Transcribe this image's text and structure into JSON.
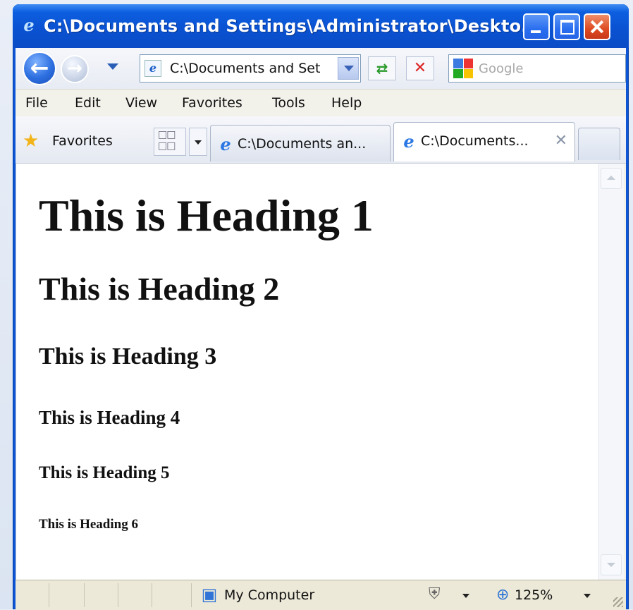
{
  "window": {
    "title": "C:\\Documents and Settings\\Administrator\\Deskto..."
  },
  "toolbar": {
    "address": "C:\\Documents and Set",
    "search_placeholder": "Google"
  },
  "menu": [
    "File",
    "Edit",
    "View",
    "Favorites",
    "Tools",
    "Help"
  ],
  "favorites": {
    "label": "Favorites"
  },
  "tabs": [
    {
      "label": "C:\\Documents an...",
      "active": false
    },
    {
      "label": "C:\\Documents...",
      "active": true
    }
  ],
  "page": {
    "h1": "This is Heading 1",
    "h2": "This is Heading 2",
    "h3": "This is Heading 3",
    "h4": "This is Heading 4",
    "h5": "This is Heading 5",
    "h6": "This is Heading 6"
  },
  "status": {
    "zone": "My Computer",
    "zoom": "125%"
  },
  "icons": {
    "ie": "ie-logo-icon",
    "back": "back-arrow-icon",
    "forward": "forward-arrow-icon",
    "refresh": "refresh-icon",
    "stop": "stop-icon",
    "search_provider": "google-logo-icon",
    "favorites": "star-icon",
    "computer": "computer-icon",
    "protected_mode": "shield-icon",
    "zoom": "zoom-icon"
  },
  "colors": {
    "titlebar": "#0b55d6",
    "close_button": "#de4a21"
  }
}
